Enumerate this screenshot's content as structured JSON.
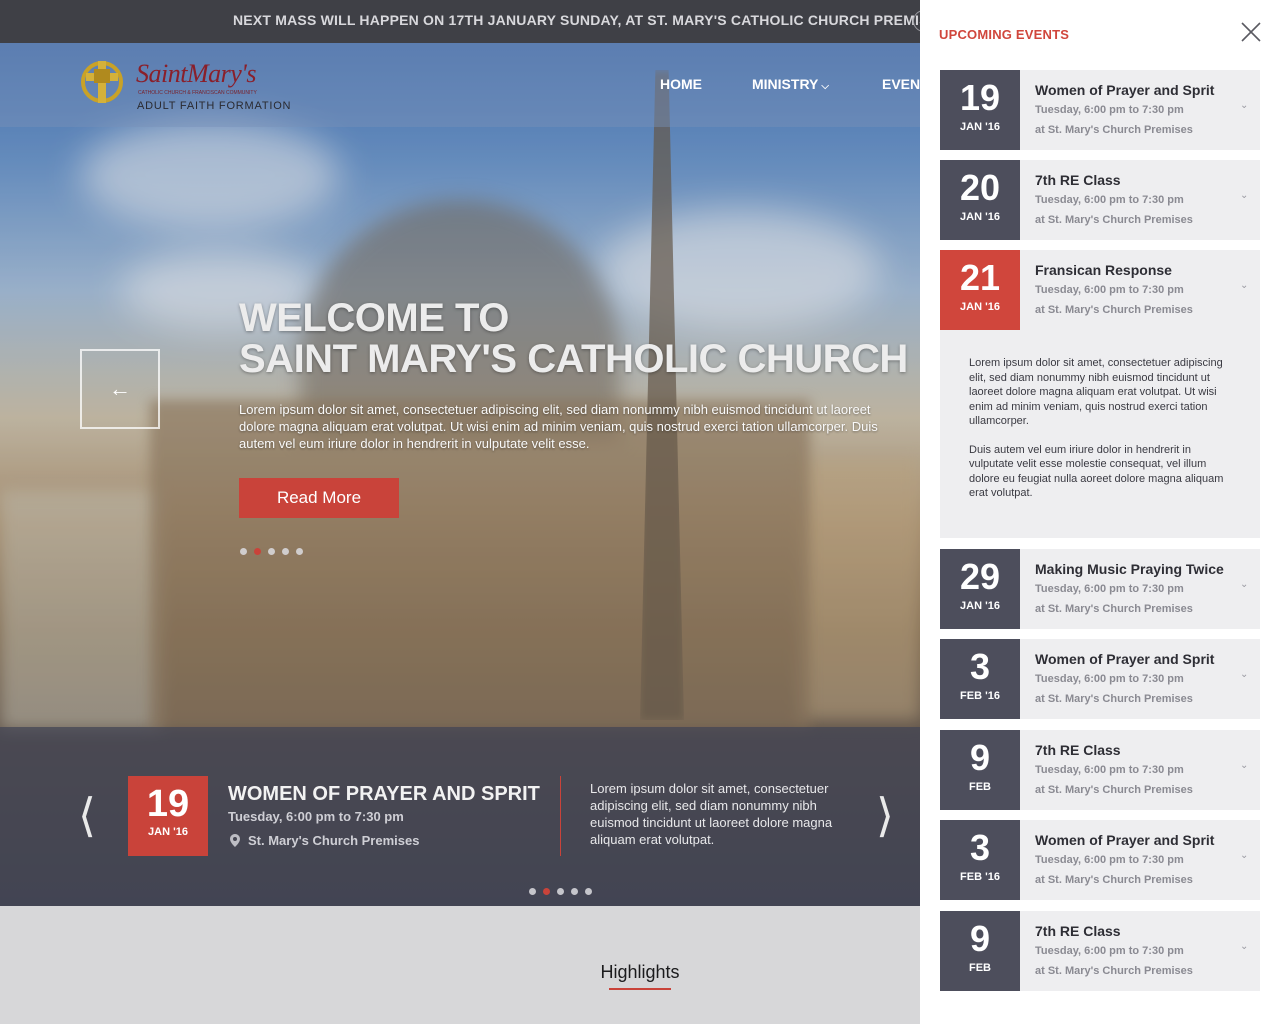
{
  "topbar": {
    "announcement": "NEXT MASS WILL HAPPEN ON 17TH JANUARY SUNDAY, AT ST. MARY'S CATHOLIC CHURCH PREMISIS"
  },
  "logo": {
    "brand": "SaintMary's",
    "tagline": "CATHOLIC CHURCH & FRANCISCAN COMMUNITY",
    "sub": "ADULT FAITH FORMATION"
  },
  "nav": {
    "items": [
      {
        "label": "HOME"
      },
      {
        "label": "MINISTRY",
        "dropdown": true
      },
      {
        "label": "EVENTS"
      }
    ]
  },
  "hero": {
    "title_line1": "WELCOME TO",
    "title_line2": "SAINT MARY'S CATHOLIC CHURCH",
    "text": "Lorem ipsum dolor sit amet, consectetuer adipiscing elit, sed diam nonummy nibh euismod tincidunt ut laoreet dolore magna aliquam erat volutpat. Ut wisi enim ad minim veniam, quis nostrud exerci tation ullamcorper. Duis autem vel eum iriure dolor in hendrerit in vulputate velit esse.",
    "button_label": "Read More",
    "slide_count": 5,
    "active_slide": 2
  },
  "featured_event": {
    "day": "19",
    "month": "JAN '16",
    "title": "WOMEN OF PRAYER AND SPRIT",
    "time": "Tuesday, 6:00 pm to 7:30 pm",
    "place": "St. Mary's Church Premises",
    "description": "Lorem ipsum dolor sit amet, consectetuer adipiscing elit, sed diam nonummy nibh euismod tincidunt ut laoreet dolore magna aliquam erat volutpat.",
    "slide_count": 5,
    "active_slide": 2
  },
  "highlights": {
    "heading": "Highlights"
  },
  "panel": {
    "title": "UPCOMING EVENTS",
    "events": [
      {
        "day": "19",
        "month": "JAN '16",
        "title": "Women of Prayer and Sprit",
        "time": "Tuesday, 6:00 pm to 7:30 pm",
        "place": "at St. Mary's Church Premises",
        "highlight": false
      },
      {
        "day": "20",
        "month": "JAN '16",
        "title": "7th RE Class",
        "time": "Tuesday, 6:00 pm to 7:30 pm",
        "place": "at St. Mary's Church Premises",
        "highlight": false
      },
      {
        "day": "21",
        "month": "JAN '16",
        "title": "Fransican Response",
        "time": "Tuesday, 6:00 pm to 7:30 pm",
        "place": "at St. Mary's Church Premises",
        "highlight": true
      },
      {
        "day": "29",
        "month": "JAN '16",
        "title": "Making Music Praying Twice",
        "time": "Tuesday, 6:00 pm to 7:30 pm",
        "place": "at St. Mary's Church Premises",
        "highlight": false
      },
      {
        "day": "3",
        "month": "FEB '16",
        "title": "Women of Prayer and Sprit",
        "time": "Tuesday, 6:00 pm to 7:30 pm",
        "place": "at St. Mary's Church Premises",
        "highlight": false
      },
      {
        "day": "9",
        "month": "FEB",
        "title": "7th RE Class",
        "time": "Tuesday, 6:00 pm to 7:30 pm",
        "place": "at St. Mary's Church Premises",
        "highlight": false
      },
      {
        "day": "3",
        "month": "FEB '16",
        "title": "Women of Prayer and Sprit",
        "time": "Tuesday, 6:00 pm to 7:30 pm",
        "place": "at St. Mary's Church Premises",
        "highlight": false
      },
      {
        "day": "9",
        "month": "FEB",
        "title": "7th RE Class",
        "time": "Tuesday, 6:00 pm to 7:30 pm",
        "place": "at St. Mary's Church Premises",
        "highlight": false
      }
    ],
    "expanded_paragraphs": [
      "Lorem ipsum dolor sit amet, consectetuer adipiscing elit, sed diam nonummy nibh euismod tincidunt ut laoreet dolore magna aliquam erat volutpat. Ut wisi enim ad minim veniam, quis nostrud exerci tation ullamcorper.",
      "Duis autem vel eum iriure dolor in hendrerit in vulputate velit esse molestie consequat, vel illum dolore eu feugiat nulla aoreet dolore magna aliquam erat volutpat."
    ]
  },
  "colors": {
    "accent": "#c9433a",
    "date_box": "#4d4e5c",
    "card_bg": "#eeeef0"
  }
}
